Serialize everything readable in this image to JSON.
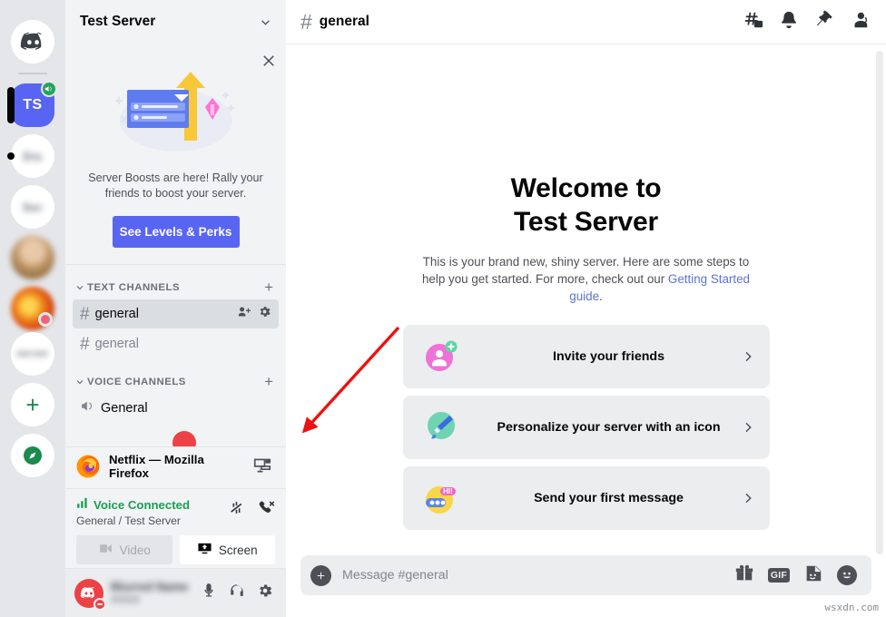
{
  "brand": "Discord",
  "server_rail": {
    "items": [
      {
        "name": "home-button",
        "label": "",
        "icon": "discord-home-icon",
        "type": "home"
      },
      {
        "name": "server-test-server",
        "label": "TS",
        "icon": "server-avatar-active",
        "type": "active",
        "badge": "voice-connected-icon"
      },
      {
        "name": "server-blurred-1",
        "label": "Dis",
        "icon": "server-avatar",
        "type": "blurred"
      },
      {
        "name": "server-blurred-2",
        "label": "Ser",
        "icon": "server-avatar",
        "type": "blurred"
      },
      {
        "name": "server-photo-1",
        "label": "",
        "icon": "server-avatar-photo",
        "type": "photo-a"
      },
      {
        "name": "server-photo-2",
        "label": "",
        "icon": "server-avatar-photo",
        "type": "photo-b",
        "status": "idle"
      },
      {
        "name": "server-blurred-3",
        "label": "server",
        "icon": "server-avatar",
        "type": "blurred"
      },
      {
        "name": "add-server-button",
        "label": "+",
        "icon": "plus-icon",
        "type": "add"
      },
      {
        "name": "explore-servers-button",
        "label": "",
        "icon": "compass-icon",
        "type": "explore"
      }
    ]
  },
  "sidebar": {
    "server_name": "Test Server",
    "chevron_icon": "chevron-down-icon",
    "boost_card": {
      "close_icon": "close-icon",
      "art_icon": "server-boost-illustration",
      "text": "Server Boosts are here! Rally your friends to boost your server.",
      "button_label": "See Levels & Perks"
    },
    "categories": [
      {
        "label": "TEXT CHANNELS",
        "caret_icon": "caret-down-icon",
        "add_icon": "plus-icon",
        "channels": [
          {
            "name": "general",
            "type": "text",
            "selected": true,
            "icon": "hash-icon",
            "actions": [
              "create-invite-icon",
              "edit-channel-icon"
            ]
          },
          {
            "name": "general",
            "type": "text",
            "selected": false,
            "icon": "hash-icon",
            "actions": []
          }
        ]
      },
      {
        "label": "VOICE CHANNELS",
        "caret_icon": "caret-down-icon",
        "add_icon": "plus-icon",
        "channels": [
          {
            "name": "General",
            "type": "voice",
            "selected": false,
            "icon": "speaker-icon",
            "actions": []
          }
        ]
      }
    ],
    "stream_row": {
      "app_icon": "firefox-icon",
      "title": "Netflix — Mozilla Firefox",
      "share_icon": "screen-share-icon"
    },
    "voice_panel": {
      "status_icon": "signal-bars-icon",
      "status_text": "Voice Connected",
      "sub_text": "General / Test Server",
      "noise_icon": "noise-suppression-icon",
      "disconnect_icon": "phone-hangup-icon",
      "video_label": "Video",
      "video_icon": "camera-icon",
      "screen_label": "Screen",
      "screen_icon": "screen-share-icon"
    },
    "user_panel": {
      "avatar_icon": "discord-avatar-icon",
      "status": "dnd",
      "username": "Blurred Name",
      "tag": "#0000",
      "icons": [
        "microphone-icon",
        "headphones-icon",
        "gear-icon"
      ]
    }
  },
  "main": {
    "header": {
      "hash_icon": "hash-icon",
      "channel_name": "general",
      "icons": [
        "threads-icon",
        "notification-bell-icon",
        "pinned-messages-icon",
        "member-list-icon"
      ]
    },
    "welcome": {
      "title_line1": "Welcome to",
      "title_line2": "Test Server",
      "subtitle_before": "This is your brand new, shiny server. Here are some steps to help you get started. For more, check out our ",
      "subtitle_link": "Getting Started guide",
      "subtitle_after": "."
    },
    "cards": [
      {
        "name": "invite-your-friends",
        "label": "Invite your friends",
        "icon": "invite-person-icon",
        "arrow_icon": "chevron-right-icon"
      },
      {
        "name": "personalize-server",
        "label": "Personalize your server with an icon",
        "icon": "paintbrush-icon",
        "arrow_icon": "chevron-right-icon"
      },
      {
        "name": "send-first-message",
        "label": "Send your first message",
        "icon": "chat-bubble-hi-icon",
        "arrow_icon": "chevron-right-icon"
      }
    ],
    "composer": {
      "plus_icon": "plus-circle-icon",
      "placeholder": "Message #general",
      "icons": [
        "gift-icon",
        "gif-icon",
        "sticker-icon",
        "emoji-icon"
      ],
      "gif_label": "GIF"
    }
  },
  "annotation": {
    "arrow_color": "#ee1111",
    "highlight_color": "#ee1111",
    "highlight_target": "screen-share-icon"
  },
  "watermark": "wsxdn.com",
  "colors": {
    "accent": "#5865f2",
    "sidebar_bg": "#f2f3f5",
    "rail_bg": "#e4e6ea",
    "main_bg": "#ffffff",
    "online_green": "#1a9e54",
    "link_blue": "#5b73d8"
  }
}
